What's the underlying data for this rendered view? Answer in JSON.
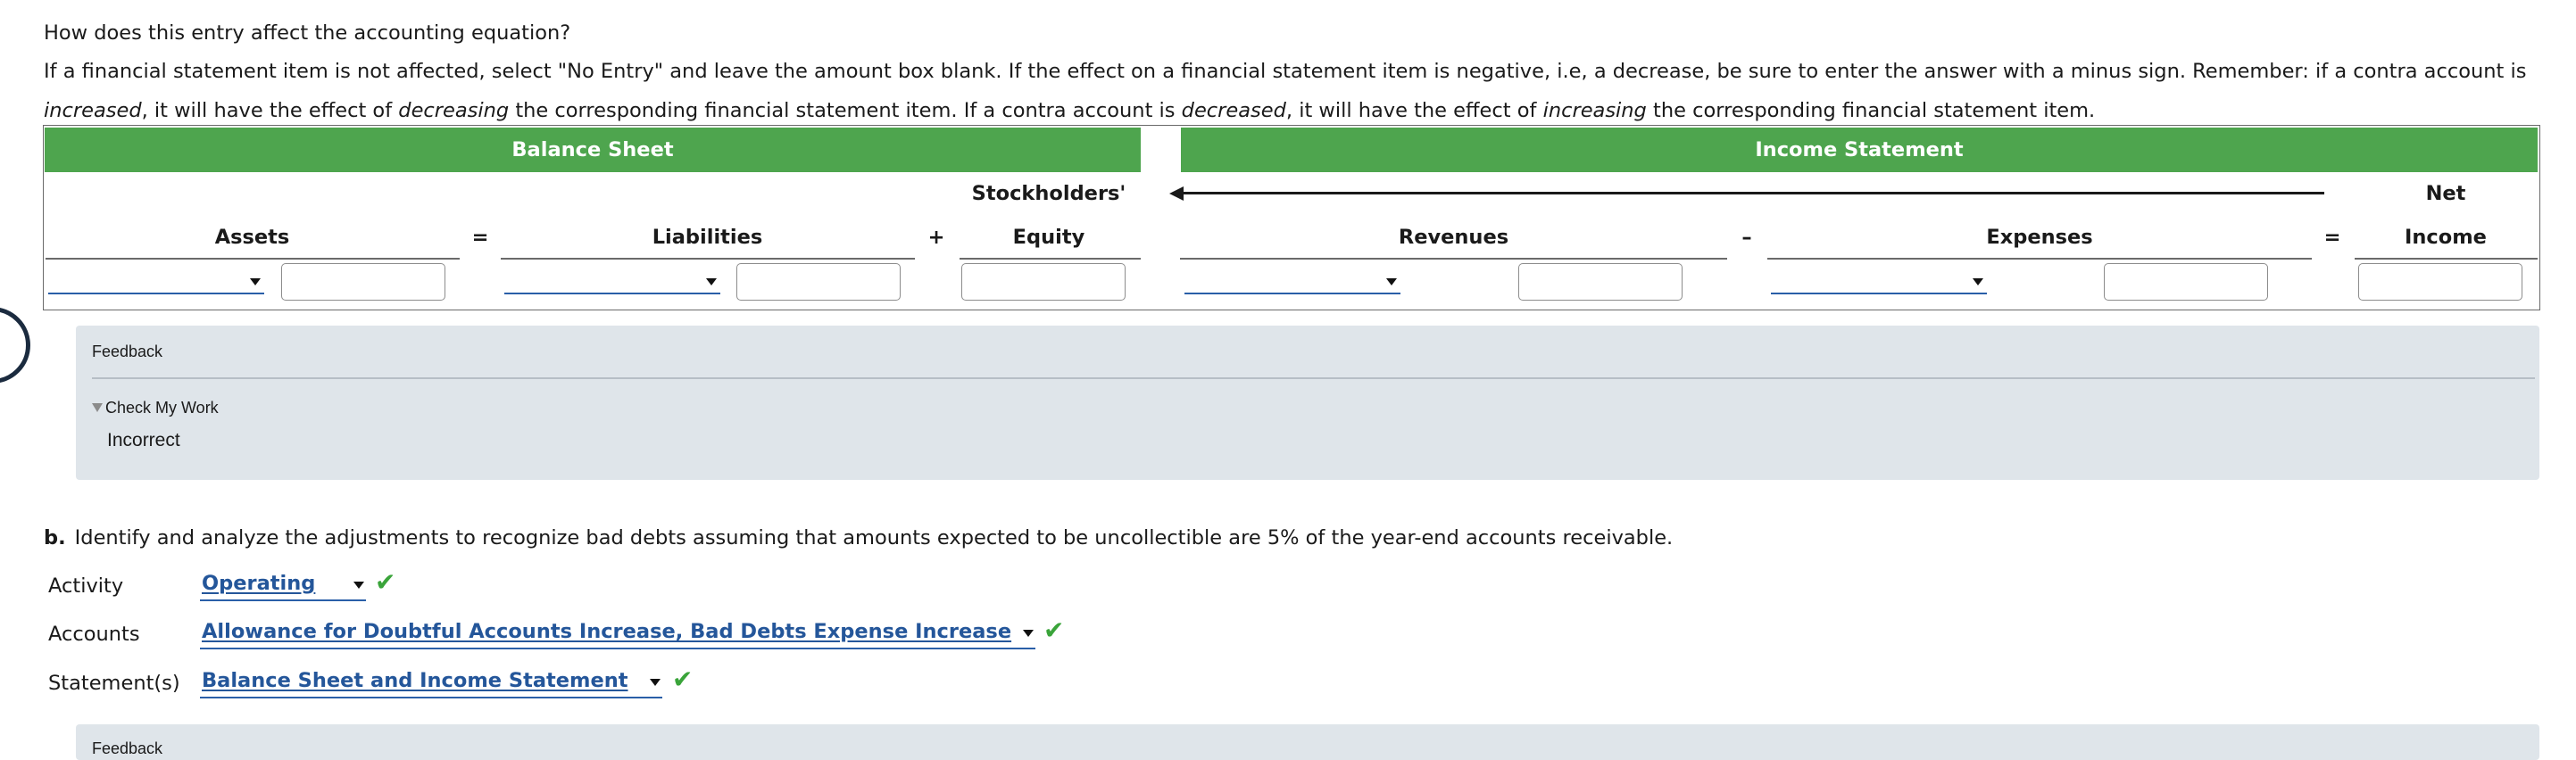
{
  "question": "How does this entry affect the accounting equation?",
  "instructions": {
    "part1": "If a financial statement item is not affected, select \"No Entry\" and leave the amount box blank. If the effect on a financial statement item is negative, i.e, a decrease, be sure to enter the answer with a minus sign. Remember: if a contra account is",
    "increased": "increased",
    "part2": ", it will have the effect of ",
    "decreasing": "decreasing",
    "part3": " the corresponding financial statement item. If a contra account is ",
    "decreased": "decreased",
    "part4": ", it will have the effect of ",
    "increasing": "increasing",
    "part5": " the corresponding financial statement item."
  },
  "table": {
    "balance_sheet": "Balance Sheet",
    "income_statement": "Income Statement",
    "stockholders": "Stockholders'",
    "net": "Net",
    "assets": "Assets",
    "eq1": "=",
    "liabilities": "Liabilities",
    "plus": "+",
    "equity": "Equity",
    "revenues": "Revenues",
    "minus": "–",
    "expenses": "Expenses",
    "eq2": "=",
    "income": "Income"
  },
  "feedback1": {
    "title": "Feedback",
    "check_my_work": "Check My Work",
    "result": "Incorrect"
  },
  "part_b": {
    "letter": "b.",
    "question": "Identify and analyze the adjustments to recognize bad debts assuming that amounts expected to be uncollectible are 5% of the year-end accounts receivable.",
    "activity_label": "Activity",
    "activity_value": "Operating",
    "accounts_label": "Accounts",
    "accounts_value": "Allowance for Doubtful Accounts Increase, Bad Debts Expense Increase",
    "statements_label": "Statement(s)",
    "statements_value": "Balance Sheet and Income Statement",
    "check": "✔"
  },
  "feedback2": {
    "title": "Feedback"
  },
  "colors": {
    "header_green": "#4ea54e",
    "feedback_bg": "#dfe5ea",
    "link_blue": "#24569a",
    "check_green": "#3aa43a"
  }
}
